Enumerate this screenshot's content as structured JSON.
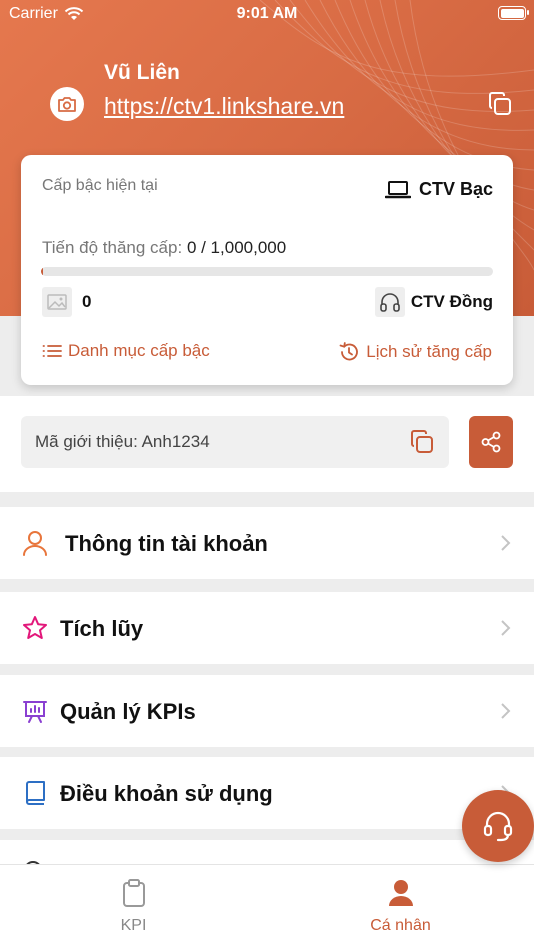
{
  "status_bar": {
    "carrier": "Carrier",
    "time": "9:01 AM"
  },
  "profile": {
    "name": "Vũ Liên",
    "link": "https://ctv1.linkshare.vn"
  },
  "rank_card": {
    "label": "Cấp bậc hiện tại",
    "current_rank": "CTV Bạc",
    "progress_label": "Tiến độ thăng cấp:",
    "progress_value": "0 / 1,000,000",
    "progress_fraction": 0,
    "points": "0",
    "next_rank": "CTV Đồng",
    "rank_list_link": "Danh mục cấp bậc",
    "history_link": "Lịch sử tăng cấp"
  },
  "referral": {
    "text": "Mã giới thiệu: Anh1234"
  },
  "menu": [
    {
      "label": "Thông tin tài khoản",
      "icon": "user-icon",
      "color": "#e8753b"
    },
    {
      "label": "Tích lũy",
      "icon": "star-icon",
      "color": "#e2177a"
    },
    {
      "label": "Quản lý KPIs",
      "icon": "presentation-icon",
      "color": "#8a3fd1"
    },
    {
      "label": "Điều khoản sử dụng",
      "icon": "book-icon",
      "color": "#2d6fc4"
    }
  ],
  "tabs": [
    {
      "label": "KPI",
      "icon": "clipboard-icon"
    },
    {
      "label": "Cá nhân",
      "icon": "person-icon"
    }
  ],
  "colors": {
    "accent": "#c85c38",
    "header": "#d86b44"
  }
}
